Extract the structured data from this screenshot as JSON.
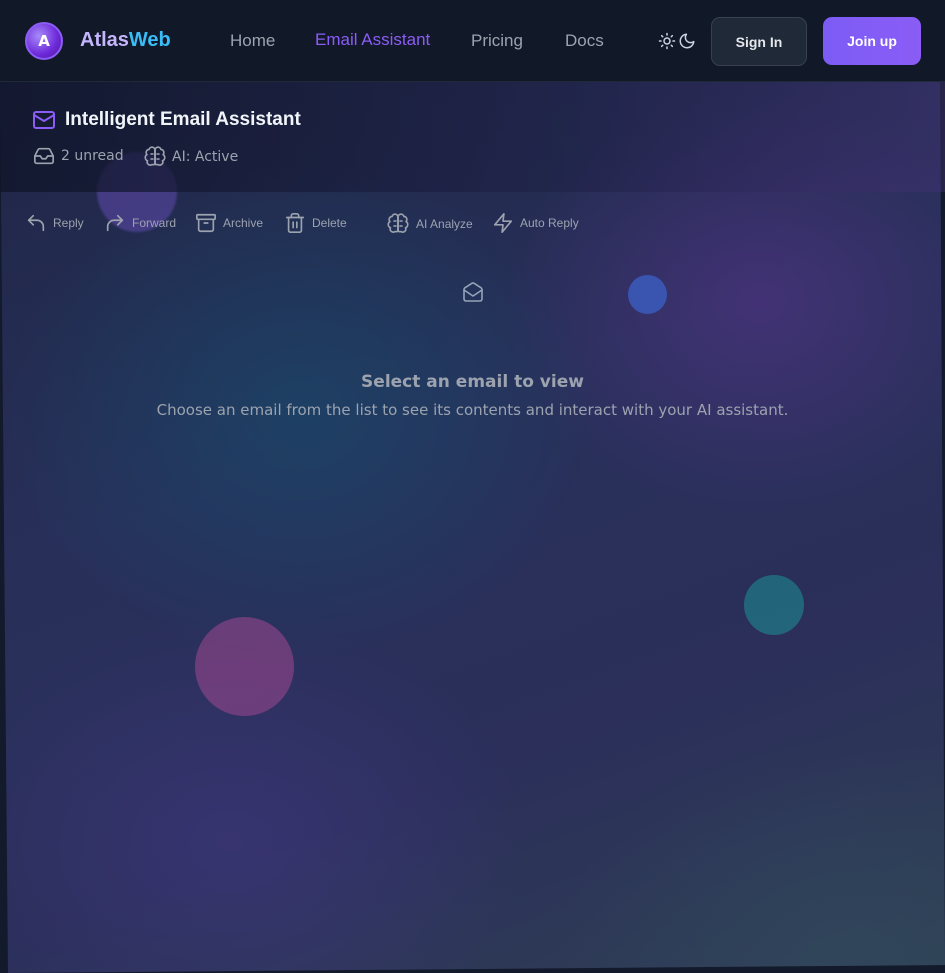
{
  "brand": {
    "logo_letter": "A",
    "name_part1": "Atlas",
    "name_part2": "Web"
  },
  "nav": {
    "items": [
      {
        "label": "Home"
      },
      {
        "label": "Email Assistant",
        "active": true
      },
      {
        "label": "Pricing"
      },
      {
        "label": "Docs"
      }
    ]
  },
  "header_actions": {
    "sign_in": "Sign In",
    "join": "Join up"
  },
  "page": {
    "title": "Intelligent Email Assistant",
    "unread": "2 unread",
    "ai_status": "AI: Active"
  },
  "toolbar": {
    "reply": "Reply",
    "forward": "Forward",
    "archive": "Archive",
    "delete": "Delete",
    "ai_analyze": "AI Analyze",
    "auto_reply": "Auto Reply"
  },
  "empty_state": {
    "title": "Select an email to view",
    "subtitle": "Choose an email from the list to see its contents and interact with your AI assistant."
  },
  "colors": {
    "accent": "#8b5cf6",
    "brand_web": "#38bdf8",
    "header_bg": "#111827"
  },
  "icons": [
    "mail-icon",
    "inbox-icon",
    "brain-icon",
    "reply-icon",
    "forward-icon",
    "archive-icon",
    "trash-icon",
    "zap-icon",
    "mail-open-icon",
    "sun-icon",
    "moon-icon"
  ]
}
